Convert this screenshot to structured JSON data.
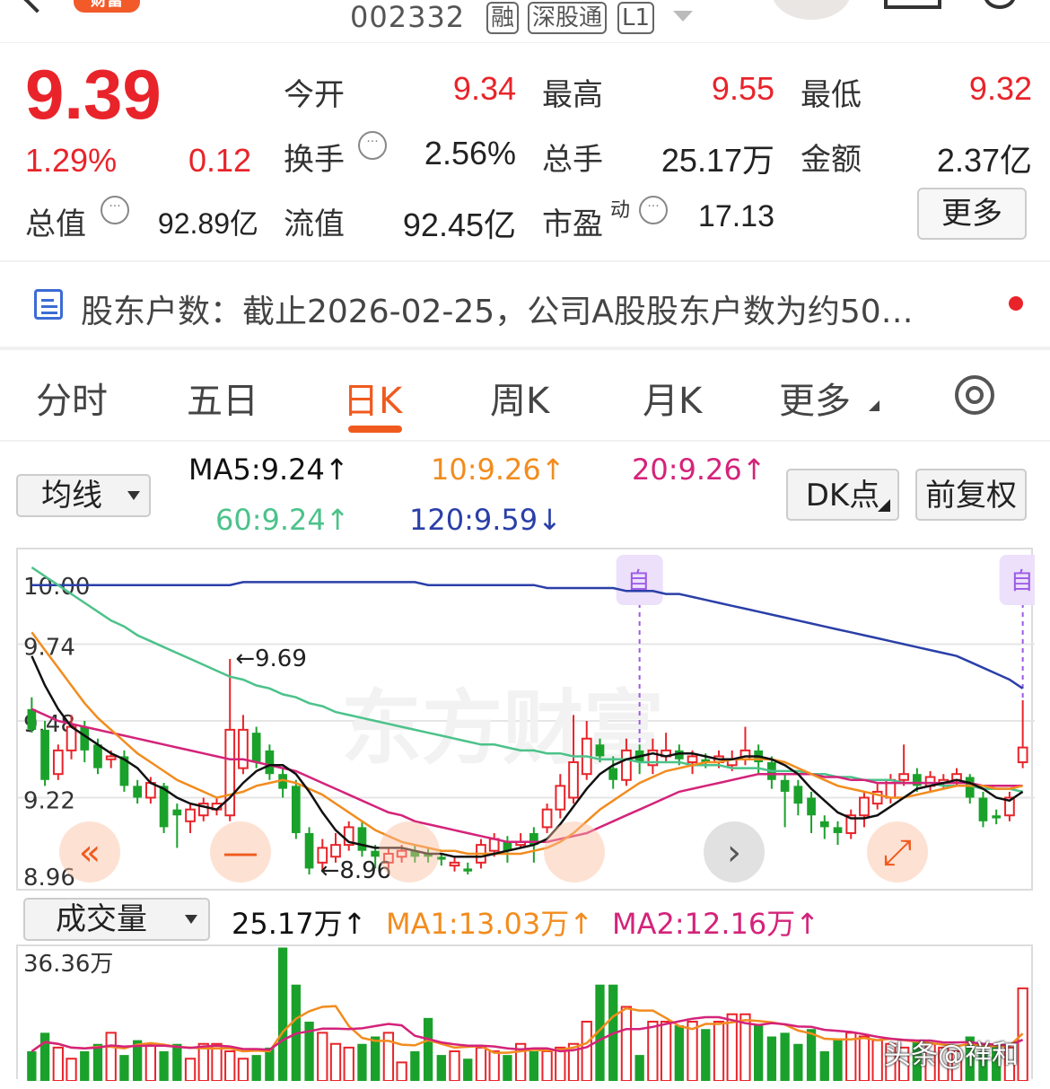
{
  "header": {
    "badge": "财富",
    "code": "002332",
    "tags": [
      "融",
      "深股通",
      "L1"
    ]
  },
  "quote": {
    "price": "9.39",
    "pct": "1.29%",
    "chg": "0.12",
    "open_label": "今开",
    "open": "9.34",
    "high_label": "最高",
    "high": "9.55",
    "low_label": "最低",
    "low": "9.32",
    "turnover_label": "换手",
    "turnover": "2.56%",
    "volume_label": "总手",
    "volume": "25.17万",
    "amount_label": "金额",
    "amount": "2.37亿",
    "mktcap_label": "总值",
    "mktcap": "92.89亿",
    "float_label": "流值",
    "float": "92.45亿",
    "pe_label": "市盈",
    "pe_sup": "动",
    "pe": "17.13",
    "more": "更多"
  },
  "news": {
    "text": "股东户数：截止2026-02-25，公司A股股东户数为约50…"
  },
  "tabs": [
    "分时",
    "五日",
    "日K",
    "周K",
    "月K",
    "更多"
  ],
  "ma_row": {
    "selector": "均线",
    "ma5": "MA5:9.24↑",
    "ma10": "10:9.26↑",
    "ma20": "20:9.26↑",
    "ma60": "60:9.24↑",
    "ma120": "120:9.59↓",
    "dk": "DK点",
    "adjust": "前复权"
  },
  "colors": {
    "up": "#e8242a",
    "down": "#1aa12b",
    "ma5": "#111111",
    "ma10": "#f28c1e",
    "ma20": "#d4237a",
    "ma60": "#4cc28a",
    "ma120": "#2a3fa8",
    "accent": "#f05a1e"
  },
  "chart_data": [
    {
      "type": "candlestick",
      "title": "",
      "y_ticks": [
        "10.00",
        "9.74",
        "9.48",
        "9.22",
        "8.96"
      ],
      "ylim": [
        8.96,
        10.0
      ],
      "annotations": {
        "max": "←9.69",
        "min": "←8.96",
        "marker": "自"
      },
      "candles": [
        [
          9.52,
          9.45,
          9.56,
          9.44
        ],
        [
          9.45,
          9.28,
          9.48,
          9.26
        ],
        [
          9.3,
          9.38,
          9.4,
          9.28
        ],
        [
          9.38,
          9.46,
          9.5,
          9.35
        ],
        [
          9.46,
          9.38,
          9.48,
          9.34
        ],
        [
          9.4,
          9.32,
          9.42,
          9.3
        ],
        [
          9.35,
          9.36,
          9.38,
          9.32
        ],
        [
          9.36,
          9.26,
          9.38,
          9.24
        ],
        [
          9.26,
          9.22,
          9.28,
          9.2
        ],
        [
          9.22,
          9.27,
          9.29,
          9.2
        ],
        [
          9.26,
          9.12,
          9.27,
          9.1
        ],
        [
          9.18,
          9.16,
          9.2,
          9.05
        ],
        [
          9.14,
          9.18,
          9.2,
          9.1
        ],
        [
          9.16,
          9.2,
          9.22,
          9.14
        ],
        [
          9.18,
          9.2,
          9.22,
          9.16
        ],
        [
          9.16,
          9.45,
          9.69,
          9.14
        ],
        [
          9.32,
          9.45,
          9.5,
          9.3
        ],
        [
          9.44,
          9.34,
          9.46,
          9.32
        ],
        [
          9.38,
          9.3,
          9.4,
          9.28
        ],
        [
          9.3,
          9.25,
          9.32,
          9.22
        ],
        [
          9.26,
          9.1,
          9.28,
          9.08
        ],
        [
          9.1,
          8.98,
          9.12,
          8.96
        ],
        [
          9.0,
          9.05,
          9.08,
          8.97
        ],
        [
          9.02,
          9.06,
          9.1,
          9.0
        ],
        [
          9.06,
          9.12,
          9.14,
          9.04
        ],
        [
          9.12,
          9.04,
          9.14,
          9.02
        ],
        [
          9.04,
          9.02,
          9.06,
          8.98
        ],
        [
          9.0,
          9.03,
          9.05,
          8.98
        ],
        [
          9.02,
          9.04,
          9.06,
          9.0
        ],
        [
          9.04,
          9.02,
          9.06,
          9.0
        ],
        [
          9.03,
          9.02,
          9.05,
          9.0
        ],
        [
          9.02,
          9.01,
          9.03,
          8.99
        ],
        [
          8.99,
          9.0,
          9.02,
          8.97
        ],
        [
          8.98,
          8.97,
          9.0,
          8.96
        ],
        [
          9.0,
          9.06,
          9.08,
          8.98
        ],
        [
          9.04,
          9.08,
          9.1,
          9.02
        ],
        [
          9.07,
          9.04,
          9.09,
          9.0
        ],
        [
          9.06,
          9.07,
          9.1,
          9.05
        ],
        [
          9.1,
          9.06,
          9.12,
          9.0
        ],
        [
          9.12,
          9.18,
          9.2,
          9.1
        ],
        [
          9.18,
          9.26,
          9.3,
          9.15
        ],
        [
          9.22,
          9.34,
          9.5,
          9.2
        ],
        [
          9.3,
          9.42,
          9.48,
          9.28
        ],
        [
          9.4,
          9.36,
          9.42,
          9.34
        ],
        [
          9.32,
          9.28,
          9.36,
          9.25
        ],
        [
          9.28,
          9.38,
          9.42,
          9.26
        ],
        [
          9.38,
          9.34,
          9.4,
          9.3
        ],
        [
          9.33,
          9.38,
          9.42,
          9.3
        ],
        [
          9.36,
          9.38,
          9.44,
          9.34
        ],
        [
          9.38,
          9.35,
          9.4,
          9.33
        ],
        [
          9.34,
          9.36,
          9.38,
          9.3
        ],
        [
          9.35,
          9.34,
          9.37,
          9.32
        ],
        [
          9.34,
          9.36,
          9.38,
          9.32
        ],
        [
          9.33,
          9.35,
          9.38,
          9.31
        ],
        [
          9.35,
          9.38,
          9.46,
          9.33
        ],
        [
          9.38,
          9.34,
          9.4,
          9.3
        ],
        [
          9.34,
          9.28,
          9.36,
          9.25
        ],
        [
          9.28,
          9.24,
          9.3,
          9.12
        ],
        [
          9.26,
          9.2,
          9.28,
          9.16
        ],
        [
          9.22,
          9.16,
          9.24,
          9.1
        ],
        [
          9.14,
          9.12,
          9.16,
          9.08
        ],
        [
          9.12,
          9.1,
          9.14,
          9.06
        ],
        [
          9.1,
          9.16,
          9.18,
          9.08
        ],
        [
          9.16,
          9.22,
          9.24,
          9.12
        ],
        [
          9.2,
          9.24,
          9.27,
          9.18
        ],
        [
          9.22,
          9.28,
          9.3,
          9.2
        ],
        [
          9.28,
          9.3,
          9.4,
          9.26
        ],
        [
          9.3,
          9.26,
          9.32,
          9.24
        ],
        [
          9.26,
          9.29,
          9.31,
          9.24
        ],
        [
          9.27,
          9.28,
          9.3,
          9.25
        ],
        [
          9.28,
          9.3,
          9.32,
          9.26
        ],
        [
          9.29,
          9.22,
          9.3,
          9.2
        ],
        [
          9.22,
          9.14,
          9.24,
          9.12
        ],
        [
          9.16,
          9.15,
          9.18,
          9.13
        ],
        [
          9.16,
          9.22,
          9.24,
          9.14
        ],
        [
          9.34,
          9.39,
          9.55,
          9.32
        ]
      ],
      "ma_lines": {
        "ma5": [
          9.7,
          9.6,
          9.52,
          9.46,
          9.43,
          9.4,
          9.37,
          9.35,
          9.32,
          9.27,
          9.25,
          9.22,
          9.2,
          9.19,
          9.18,
          9.22,
          9.27,
          9.31,
          9.33,
          9.33,
          9.3,
          9.24,
          9.17,
          9.11,
          9.07,
          9.06,
          9.05,
          9.05,
          9.05,
          9.04,
          9.03,
          9.03,
          9.02,
          9.02,
          9.02,
          9.03,
          9.04,
          9.05,
          9.06,
          9.08,
          9.13,
          9.19,
          9.25,
          9.3,
          9.33,
          9.35,
          9.36,
          9.37,
          9.36,
          9.37,
          9.37,
          9.36,
          9.35,
          9.35,
          9.36,
          9.36,
          9.35,
          9.33,
          9.3,
          9.25,
          9.21,
          9.17,
          9.15,
          9.15,
          9.16,
          9.19,
          9.22,
          9.25,
          9.26,
          9.27,
          9.28,
          9.27,
          9.25,
          9.22,
          9.21,
          9.24
        ],
        "ma10": [
          9.78,
          9.72,
          9.66,
          9.6,
          9.54,
          9.49,
          9.45,
          9.41,
          9.37,
          9.34,
          9.31,
          9.28,
          9.26,
          9.24,
          9.22,
          9.23,
          9.24,
          9.26,
          9.27,
          9.28,
          9.27,
          9.25,
          9.23,
          9.2,
          9.17,
          9.14,
          9.11,
          9.09,
          9.07,
          9.06,
          9.05,
          9.04,
          9.04,
          9.03,
          9.03,
          9.03,
          9.03,
          9.03,
          9.04,
          9.05,
          9.07,
          9.1,
          9.14,
          9.18,
          9.21,
          9.24,
          9.27,
          9.29,
          9.31,
          9.32,
          9.33,
          9.34,
          9.34,
          9.35,
          9.35,
          9.35,
          9.35,
          9.34,
          9.32,
          9.3,
          9.28,
          9.26,
          9.25,
          9.24,
          9.23,
          9.22,
          9.22,
          9.23,
          9.24,
          9.25,
          9.26,
          9.26,
          9.26,
          9.25,
          9.25,
          9.26
        ],
        "ma20": [
          9.52,
          9.5,
          9.48,
          9.47,
          9.46,
          9.45,
          9.44,
          9.43,
          9.42,
          9.41,
          9.4,
          9.39,
          9.38,
          9.37,
          9.36,
          9.35,
          9.35,
          9.34,
          9.33,
          9.32,
          9.31,
          9.29,
          9.27,
          9.25,
          9.23,
          9.21,
          9.19,
          9.17,
          9.16,
          9.14,
          9.13,
          9.12,
          9.11,
          9.1,
          9.09,
          9.08,
          9.07,
          9.07,
          9.07,
          9.07,
          9.08,
          9.09,
          9.1,
          9.12,
          9.14,
          9.16,
          9.18,
          9.2,
          9.22,
          9.24,
          9.25,
          9.26,
          9.27,
          9.28,
          9.29,
          9.3,
          9.3,
          9.3,
          9.3,
          9.3,
          9.29,
          9.29,
          9.28,
          9.28,
          9.27,
          9.27,
          9.27,
          9.27,
          9.27,
          9.27,
          9.27,
          9.27,
          9.26,
          9.26,
          9.26,
          9.26
        ],
        "ma60": [
          10.0,
          9.97,
          9.94,
          9.91,
          9.88,
          9.85,
          9.82,
          9.8,
          9.77,
          9.75,
          9.73,
          9.71,
          9.69,
          9.67,
          9.65,
          9.63,
          9.62,
          9.6,
          9.59,
          9.57,
          9.56,
          9.54,
          9.53,
          9.51,
          9.5,
          9.49,
          9.48,
          9.47,
          9.46,
          9.45,
          9.44,
          9.43,
          9.42,
          9.41,
          9.4,
          9.4,
          9.39,
          9.38,
          9.38,
          9.37,
          9.37,
          9.36,
          9.36,
          9.35,
          9.35,
          9.35,
          9.34,
          9.34,
          9.34,
          9.34,
          9.33,
          9.33,
          9.33,
          9.32,
          9.32,
          9.32,
          9.31,
          9.31,
          9.31,
          9.3,
          9.3,
          9.29,
          9.29,
          9.28,
          9.28,
          9.28,
          9.27,
          9.27,
          9.27,
          9.26,
          9.26,
          9.26,
          9.25,
          9.25,
          9.25,
          9.24
        ],
        "ma120": [
          9.94,
          9.94,
          9.94,
          9.94,
          9.94,
          9.94,
          9.94,
          9.94,
          9.94,
          9.94,
          9.94,
          9.94,
          9.94,
          9.94,
          9.94,
          9.94,
          9.95,
          9.95,
          9.95,
          9.95,
          9.95,
          9.95,
          9.95,
          9.95,
          9.95,
          9.95,
          9.95,
          9.95,
          9.95,
          9.95,
          9.94,
          9.94,
          9.94,
          9.94,
          9.94,
          9.94,
          9.94,
          9.94,
          9.94,
          9.93,
          9.93,
          9.93,
          9.93,
          9.93,
          9.93,
          9.92,
          9.92,
          9.92,
          9.91,
          9.91,
          9.9,
          9.89,
          9.88,
          9.87,
          9.86,
          9.85,
          9.84,
          9.83,
          9.82,
          9.81,
          9.8,
          9.79,
          9.78,
          9.77,
          9.76,
          9.75,
          9.74,
          9.73,
          9.72,
          9.71,
          9.7,
          9.68,
          9.66,
          9.64,
          9.62,
          9.59
        ]
      }
    },
    {
      "type": "bar",
      "title": "",
      "selector": "成交量",
      "legend": {
        "vol": "25.17万↑",
        "ma1": "MA1:13.03万↑",
        "ma2": "MA2:12.16万↑"
      },
      "y_max_label": "36.36万",
      "ylim": [
        0,
        36.36
      ],
      "values": [
        8,
        13,
        9,
        6,
        8,
        10,
        13,
        7,
        11,
        10,
        8,
        10,
        6,
        10,
        10,
        8,
        6,
        7,
        9,
        36,
        26,
        16,
        13,
        10,
        9,
        10,
        12,
        13,
        5,
        8,
        17,
        7,
        8,
        6,
        9,
        8,
        7,
        10,
        8,
        8,
        9,
        10,
        16,
        26,
        26,
        20,
        7,
        16,
        16,
        15,
        16,
        14,
        16,
        18,
        18,
        15,
        12,
        13,
        10,
        14,
        8,
        11,
        13,
        12,
        11,
        10,
        9,
        11,
        10,
        9,
        8,
        12,
        8,
        10,
        9,
        25
      ]
    }
  ],
  "watermark": "头条@祥和"
}
